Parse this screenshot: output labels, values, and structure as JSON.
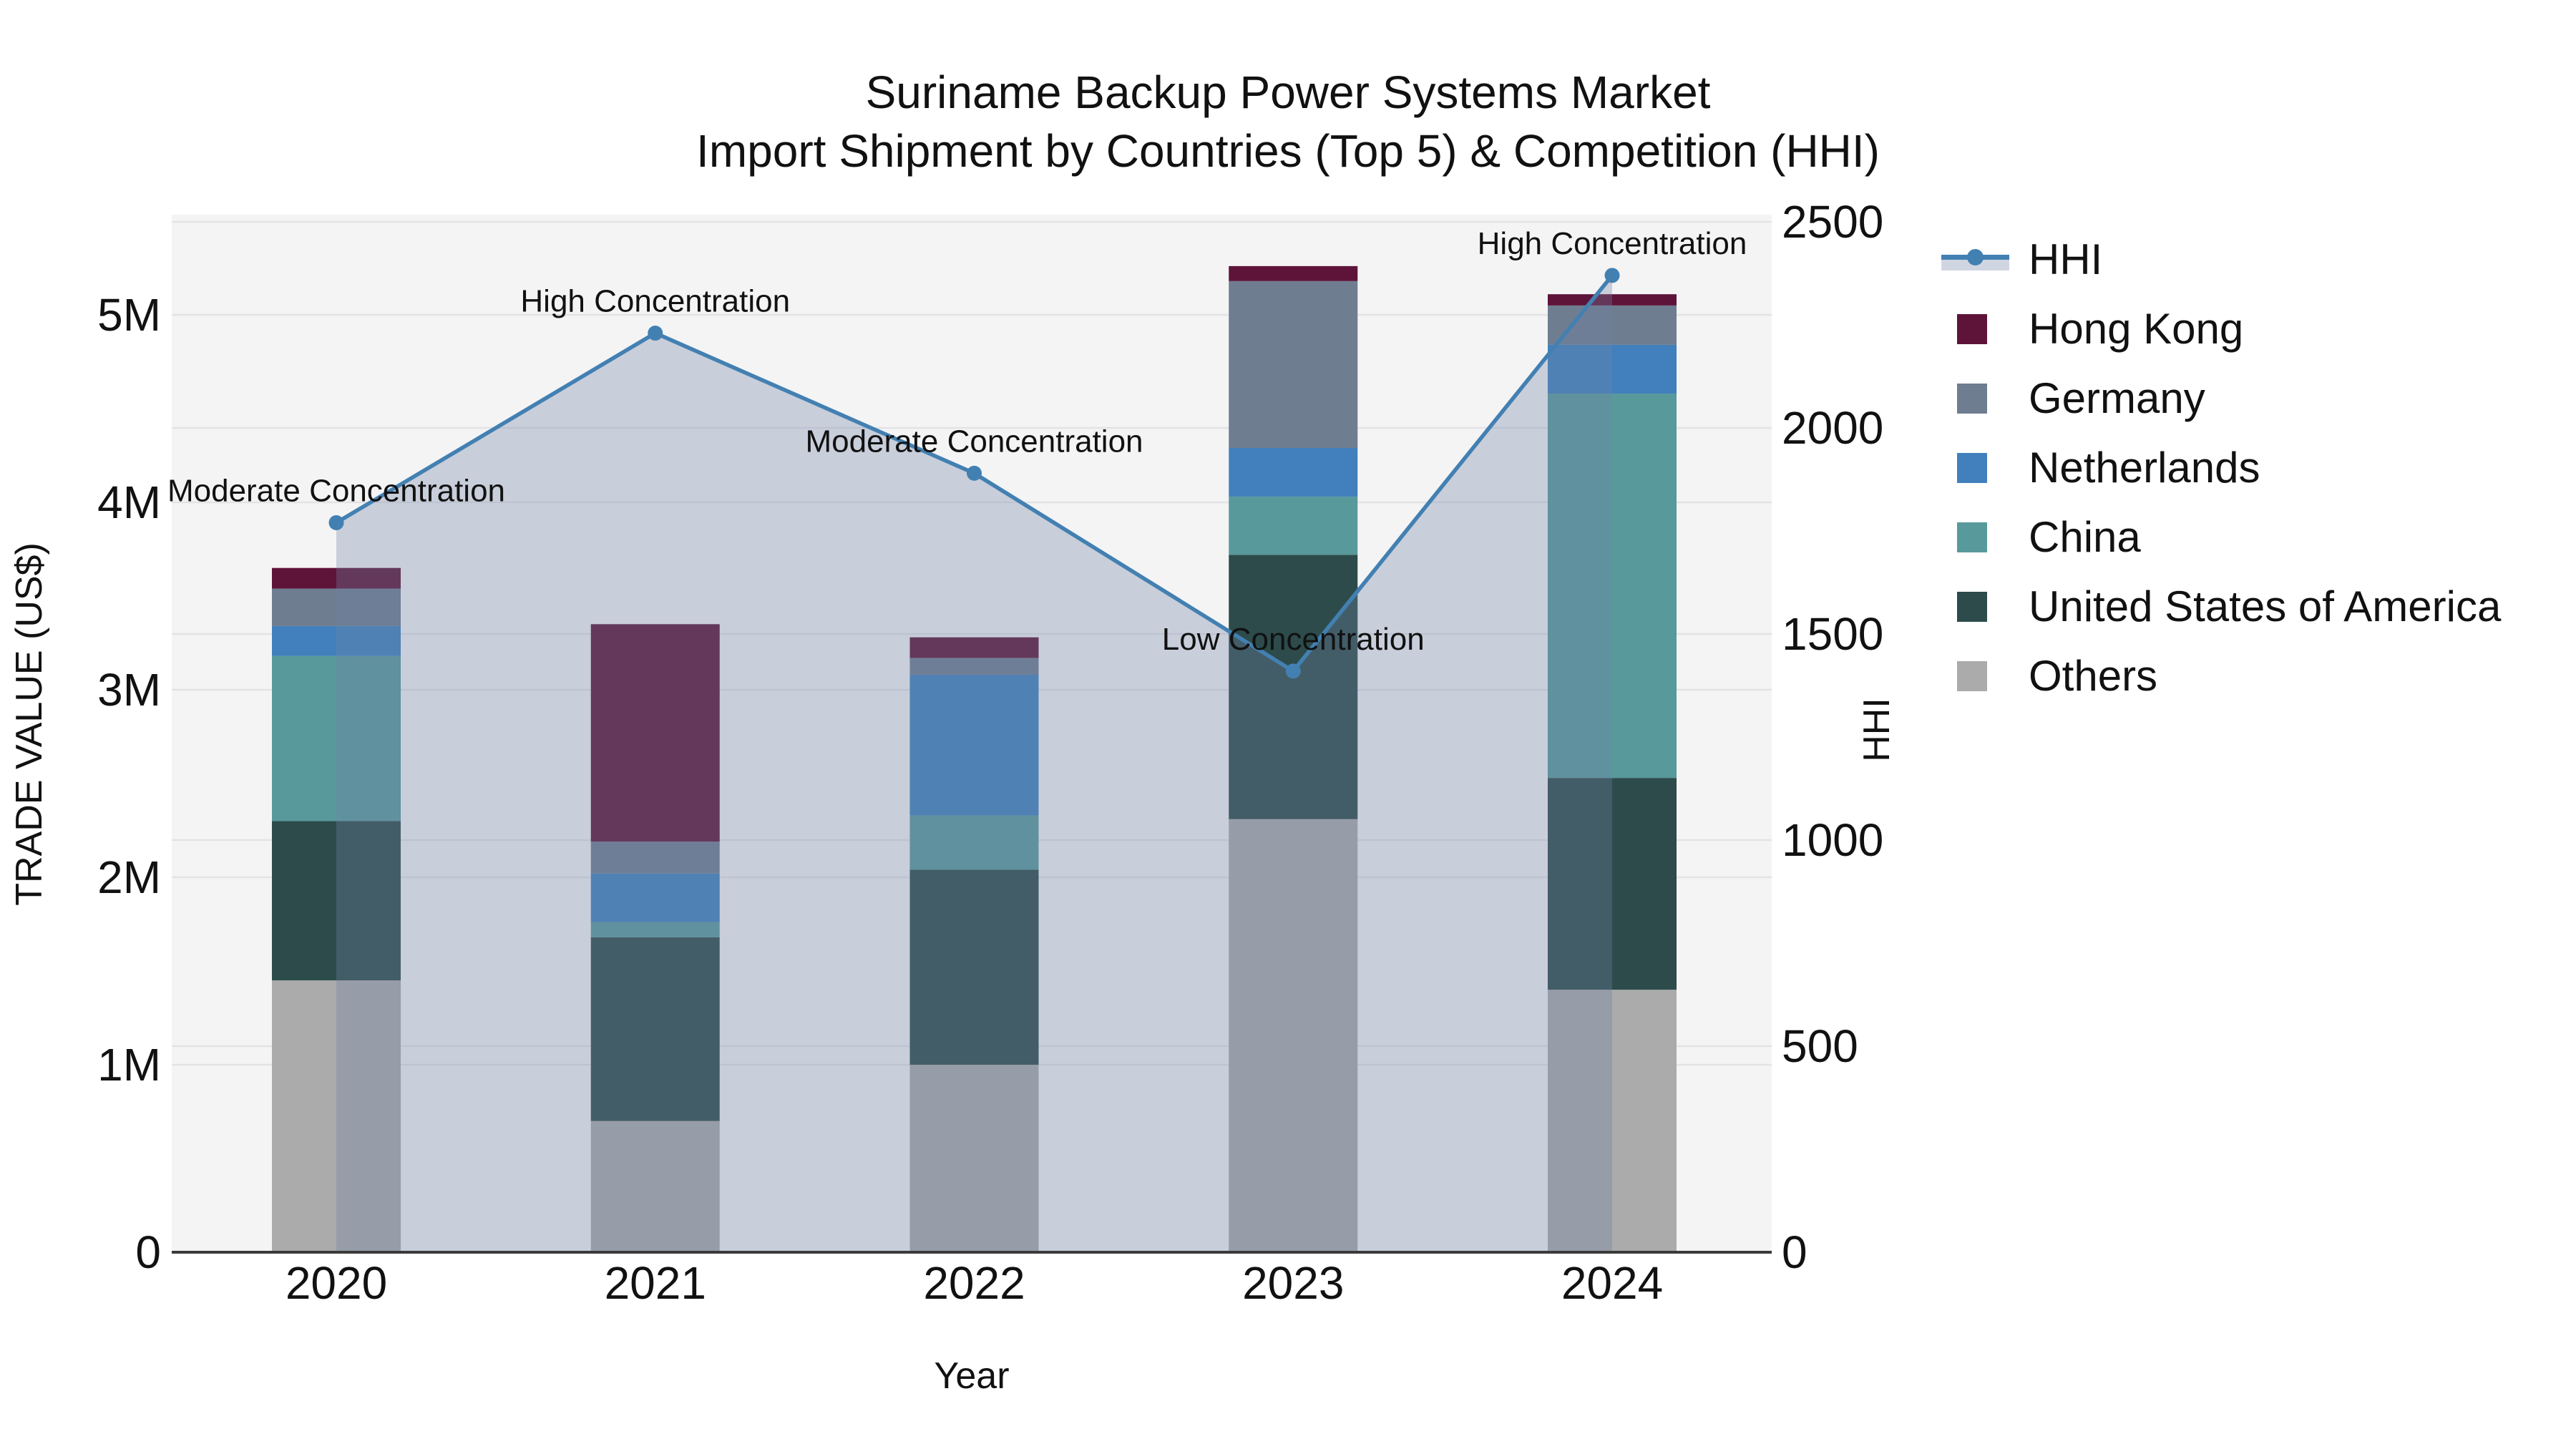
{
  "title": {
    "line1": "Suriname Backup Power Systems Market",
    "line2": "Import Shipment by Countries (Top 5) & Competition (HHI)"
  },
  "axes": {
    "x_label": "Year",
    "y_left_label": "TRADE VALUE (US$)",
    "y_right_label": "HHI",
    "y_left_ticks": [
      "0",
      "1M",
      "2M",
      "3M",
      "4M",
      "5M"
    ],
    "y_right_ticks": [
      "0",
      "500",
      "1000",
      "1500",
      "2000",
      "2500"
    ],
    "y_left_max_label_value_m": 5,
    "y_right_max": 2500
  },
  "chart_data": {
    "type": "bar",
    "subtype": "stacked-bars-with-line-overlay",
    "categories": [
      "2020",
      "2021",
      "2022",
      "2023",
      "2024"
    ],
    "x_axis_label": "Year",
    "y_left_axis": {
      "label": "TRADE VALUE (US$)",
      "range_m": [
        0,
        5.5
      ],
      "gridline_step_m": 1
    },
    "y_right_axis": {
      "label": "HHI",
      "range": [
        0,
        2500
      ],
      "gridline_step": 500
    },
    "series": [
      {
        "name": "Others",
        "color": "#ababab",
        "values_musd": [
          1.45,
          0.7,
          1.0,
          2.31,
          1.4
        ]
      },
      {
        "name": "United States of America",
        "color": "#2d4b4b",
        "values_musd": [
          0.85,
          0.98,
          1.04,
          1.41,
          1.13
        ]
      },
      {
        "name": "China",
        "color": "#58999b",
        "values_musd": [
          0.88,
          0.08,
          0.29,
          0.31,
          2.05
        ]
      },
      {
        "name": "Netherlands",
        "color": "#4180bc",
        "values_musd": [
          0.16,
          0.26,
          0.75,
          0.26,
          0.26
        ]
      },
      {
        "name": "Germany",
        "color": "#6f7d91",
        "values_musd": [
          0.2,
          0.17,
          0.09,
          0.89,
          0.21
        ]
      },
      {
        "name": "Hong Kong",
        "color": "#5e1438",
        "values_musd": [
          0.11,
          1.16,
          0.11,
          0.08,
          0.06
        ]
      }
    ],
    "line_series": {
      "name": "HHI",
      "color": "#4380b2",
      "area_fill_color": "#7184a3",
      "area_fill_alpha": 0.33,
      "values": [
        1770,
        2230,
        1890,
        1410,
        2370
      ]
    },
    "annotations": [
      {
        "category": "2020",
        "text": "Moderate Concentration"
      },
      {
        "category": "2021",
        "text": "High Concentration"
      },
      {
        "category": "2022",
        "text": "Moderate Concentration"
      },
      {
        "category": "2023",
        "text": "Low Concentration"
      },
      {
        "category": "2024",
        "text": "High Concentration"
      }
    ],
    "legend_position": "right-outside",
    "grid": true
  },
  "legend": {
    "items": [
      {
        "label": "HHI",
        "type": "line",
        "color": "#4380b2"
      },
      {
        "label": "Hong Kong",
        "type": "square",
        "color": "#5e1438"
      },
      {
        "label": "Germany",
        "type": "square",
        "color": "#6f7d91"
      },
      {
        "label": "Netherlands",
        "type": "square",
        "color": "#4180bc"
      },
      {
        "label": "China",
        "type": "square",
        "color": "#58999b"
      },
      {
        "label": "United States of America",
        "type": "square",
        "color": "#2d4b4b"
      },
      {
        "label": "Others",
        "type": "square",
        "color": "#ababab"
      }
    ]
  },
  "colors": {
    "plot_background": "#f4f4f5",
    "figure_background": "#ffffff",
    "gridline": "#e3e3e6",
    "axis_spine": "#3b3b3b",
    "text": "#111111"
  }
}
